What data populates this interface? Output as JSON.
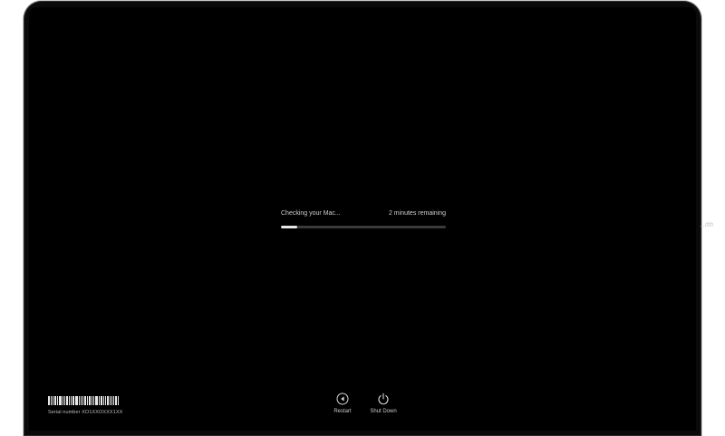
{
  "progress": {
    "status_label": "Checking your Mac...",
    "time_remaining": "2 minutes remaining",
    "fraction": 0.1
  },
  "serial": {
    "label": "Serial number XO1XXOXXX1XX"
  },
  "actions": {
    "restart_label": "Restart",
    "shutdown_label": "Shut Down"
  },
  "watermark": {
    "text": "...dth"
  },
  "colors": {
    "screen": "#000000",
    "bezel": "#0a0a0a",
    "progress_fill": "#e6e6e6",
    "progress_track": "#3a3a3a",
    "text": "#cfcfcf"
  },
  "icons": {
    "restart": "restart-arrow-icon",
    "shutdown": "power-icon"
  }
}
